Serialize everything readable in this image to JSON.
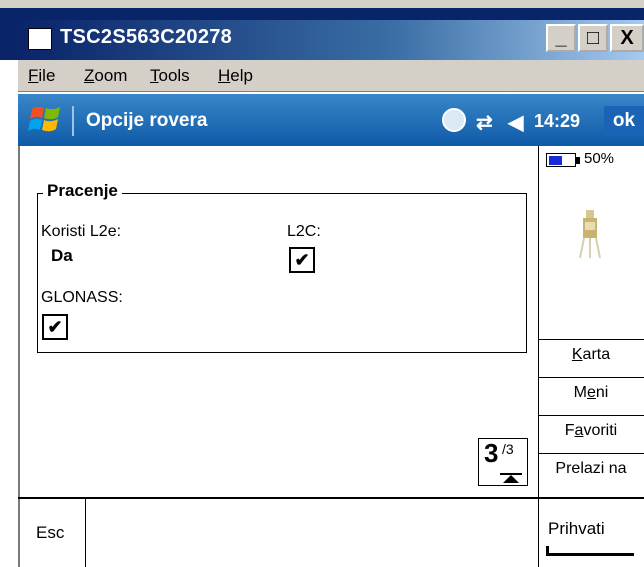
{
  "window": {
    "title": "TSC2S563C20278",
    "minimize_label": "_",
    "maximize_label": "□",
    "close_label": "X"
  },
  "menu": {
    "items": [
      {
        "label": "File",
        "mnemonic": "F"
      },
      {
        "label": "Zoom",
        "mnemonic": "Z"
      },
      {
        "label": "Tools",
        "mnemonic": "T"
      },
      {
        "label": "Help",
        "mnemonic": "H"
      }
    ]
  },
  "pda_bar": {
    "title": "Opcije rovera",
    "time": "14:29",
    "ok_label": "ok",
    "icons": [
      "sync-icon",
      "connectivity-icon",
      "volume-icon"
    ]
  },
  "group": {
    "title": "Pracenje",
    "koristi_label": "Koristi L2e:",
    "koristi_value": "Da",
    "l2c_label": "L2C:",
    "l2c_checked": true,
    "glonass_label": "GLONASS:",
    "glonass_checked": true,
    "check_glyph": "✔"
  },
  "status": {
    "battery_percent": 50,
    "battery_text": "50%"
  },
  "side_buttons": [
    {
      "label": "Karta",
      "mnemonic": "K"
    },
    {
      "label": "Meni",
      "mnemonic": "e"
    },
    {
      "label": "Favoriti",
      "mnemonic": "a"
    },
    {
      "label": "Prelazi na"
    }
  ],
  "page_indicator": {
    "current": "3",
    "total": "/3"
  },
  "bottom": {
    "esc_label": "Esc",
    "accept_label": "Prihvati"
  },
  "colors": {
    "titlebar_start": "#0a246a",
    "pda_bar": "#1b63b4",
    "battery": "#1a2ad8"
  }
}
